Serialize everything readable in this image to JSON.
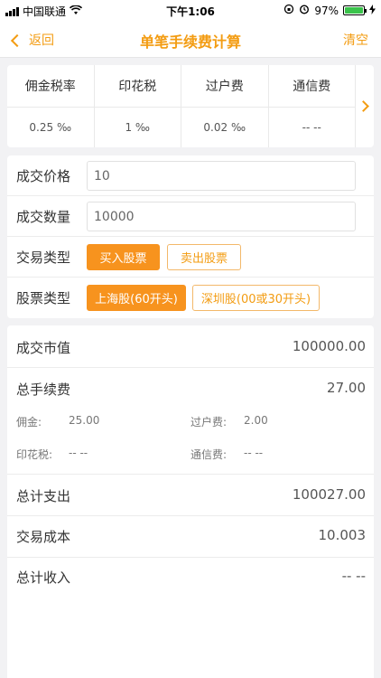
{
  "status_bar": {
    "carrier": "中国联通",
    "time": "下午1:06",
    "battery": "97%"
  },
  "nav": {
    "back_label": "返回",
    "title": "单笔手续费计算",
    "clear_label": "清空"
  },
  "rates": {
    "headers": [
      "佣金税率",
      "印花税",
      "过户费",
      "通信费"
    ],
    "values": [
      "0.25 ‰",
      "1 ‰",
      "0.02 ‰",
      "-- --"
    ]
  },
  "form": {
    "price_label": "成交价格",
    "price_value": "10",
    "quantity_label": "成交数量",
    "quantity_value": "10000",
    "trade_type_label": "交易类型",
    "buy_label": "买入股票",
    "sell_label": "卖出股票",
    "stock_type_label": "股票类型",
    "shanghai_label": "上海股(60开头)",
    "shenzhen_label": "深圳股(00或30开头)"
  },
  "results": {
    "market_value_label": "成交市值",
    "market_value": "100000.00",
    "total_fee_label": "总手续费",
    "total_fee": "27.00",
    "commission_label": "佣金:",
    "commission": "25.00",
    "transfer_label": "过户费:",
    "transfer": "2.00",
    "stamp_label": "印花税:",
    "stamp": "-- --",
    "comm_fee_label": "通信费:",
    "comm_fee": "-- --",
    "total_expense_label": "总计支出",
    "total_expense": "100027.00",
    "cost_label": "交易成本",
    "cost": "10.003",
    "total_income_label": "总计收入",
    "total_income": "-- --"
  },
  "colors": {
    "accent": "#f39c12",
    "button_active": "#f7931e",
    "battery": "#3ac34b"
  }
}
